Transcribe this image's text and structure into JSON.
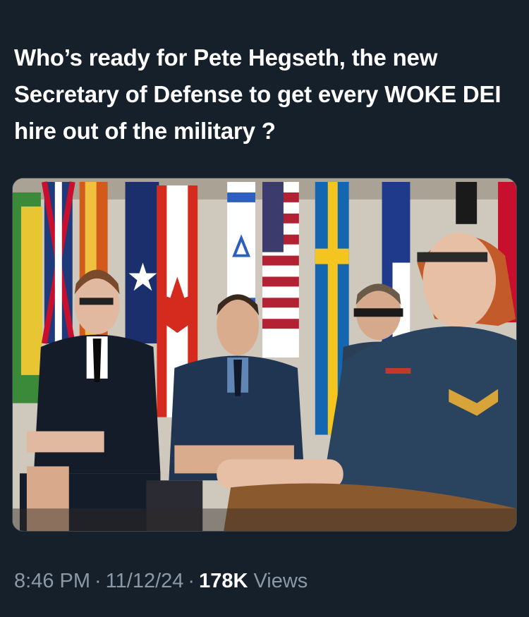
{
  "tweet": {
    "text": "Who’s ready for Pete Hegseth, the new Secretary of Defense to get every WOKE DEI hire out of the military ?",
    "time": "8:46 PM",
    "separator": "·",
    "date": "11/12/24",
    "views_count": "178K",
    "views_label": "Views"
  },
  "media": {
    "type": "photo",
    "description_icon": "photo-of-uniformed-personnel-seated-before-row-of-national-flags"
  },
  "colors": {
    "background": "#15202b",
    "text_primary": "#ffffff",
    "text_secondary": "#8b98a5",
    "border": "#38444d"
  }
}
